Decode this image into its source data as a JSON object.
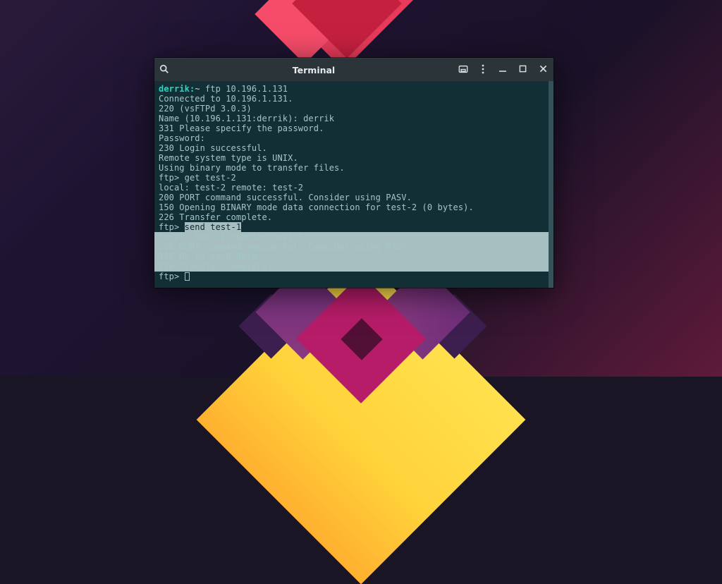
{
  "window": {
    "title": "Terminal"
  },
  "titlebar_icons": {
    "search": "search-icon",
    "newtab": "new-terminal-icon",
    "menu": "menu-icon",
    "minimize": "minimize-icon",
    "maximize": "maximize-icon",
    "close": "close-icon"
  },
  "prompt": {
    "user_host": "derrik:",
    "path": "~",
    "command": "ftp 10.196.1.131"
  },
  "lines": {
    "l1": "Connected to 10.196.1.131.",
    "l2": "220 (vsFTPd 3.0.3)",
    "l3": "Name (10.196.1.131:derrik): derrik",
    "l4": "331 Please specify the password.",
    "l5": "Password:",
    "l6": "230 Login successful.",
    "l7": "Remote system type is UNIX.",
    "l8": "Using binary mode to transfer files.",
    "l9_prompt": "ftp> ",
    "l9_cmd": "get test-2",
    "l10": "local: test-2 remote: test-2",
    "l11": "200 PORT command successful. Consider using PASV.",
    "l12": "150 Opening BINARY mode data connection for test-2 (0 bytes).",
    "l13": "226 Transfer complete.",
    "l14_prompt": "ftp> ",
    "l14_cmd": "send test-1",
    "l15": "local: test-1 remote: test-1",
    "l16": "200 PORT command successful. Consider using PASV.",
    "l17": "150 Ok to send data.",
    "l18": "226 Transfer complete.",
    "l19": "ftp> "
  },
  "colors": {
    "terminal_bg": "#122f36",
    "terminal_fg": "#a3c6c8",
    "prompt_fg": "#2ed3c3",
    "selection_bg": "#a8bfc1",
    "titlebar_bg": "#2b3439"
  }
}
